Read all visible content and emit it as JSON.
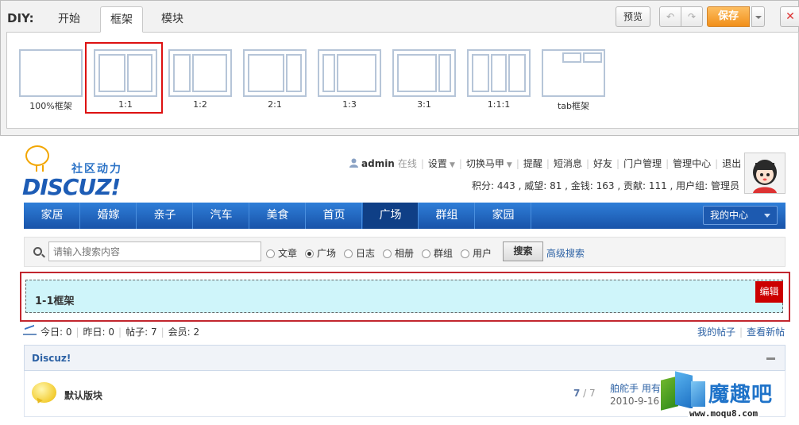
{
  "diy": {
    "title": "DIY:",
    "tabs": [
      {
        "label": "开始"
      },
      {
        "label": "框架"
      },
      {
        "label": "模块"
      }
    ],
    "preview_label": "预览",
    "undo_icon": "↶",
    "redo_icon": "↷",
    "save_label": "保存",
    "close_icon": "✕",
    "frames": [
      {
        "label": "100%框架"
      },
      {
        "label": "1:1"
      },
      {
        "label": "1:2"
      },
      {
        "label": "2:1"
      },
      {
        "label": "1:3"
      },
      {
        "label": "3:1"
      },
      {
        "label": "1:1:1"
      },
      {
        "label": "tab框架"
      }
    ]
  },
  "site": {
    "logo_slogan": "社区动力",
    "logo_text": "DISCUZ!"
  },
  "userbar": {
    "username": "admin",
    "online": "在线",
    "links": [
      "设置",
      "切换马甲",
      "提醒",
      "短消息",
      "好友",
      "门户管理",
      "管理中心",
      "退出"
    ],
    "credits": "积分: 443 , 威望: 81 , 金钱: 163 , 贡献: 111 , 用户组: 管理员"
  },
  "nav": {
    "items": [
      "家居",
      "婚嫁",
      "亲子",
      "汽车",
      "美食",
      "首页",
      "广场",
      "群组",
      "家园"
    ],
    "my_center": "我的中心"
  },
  "search": {
    "placeholder": "请输入搜索内容",
    "options": [
      "文章",
      "广场",
      "日志",
      "相册",
      "群组",
      "用户"
    ],
    "button": "搜索",
    "advanced": "高级搜索"
  },
  "frame_block": {
    "title": "1-1框架",
    "edit": "编辑"
  },
  "stats": {
    "today": "今日: 0",
    "yesterday": "昨日: 0",
    "posts": "帖子: 7",
    "members": "会员: 2",
    "my_posts": "我的帖子",
    "new_posts": "查看新帖"
  },
  "forum": {
    "category": "Discuz!",
    "name": "默认版块",
    "threads": "7",
    "posts": "7",
    "last_user": "舶舵手 用有",
    "last_date": "2010-9-16"
  },
  "watermark": {
    "text": "魔趣吧",
    "url": "www.moqu8.com"
  },
  "colors": {
    "nav_bg": "#1853a9",
    "save_orange": "#f18f19",
    "highlight_red": "#cc0000",
    "frame_fill": "#cff5fa",
    "link_blue": "#2d62a5"
  }
}
